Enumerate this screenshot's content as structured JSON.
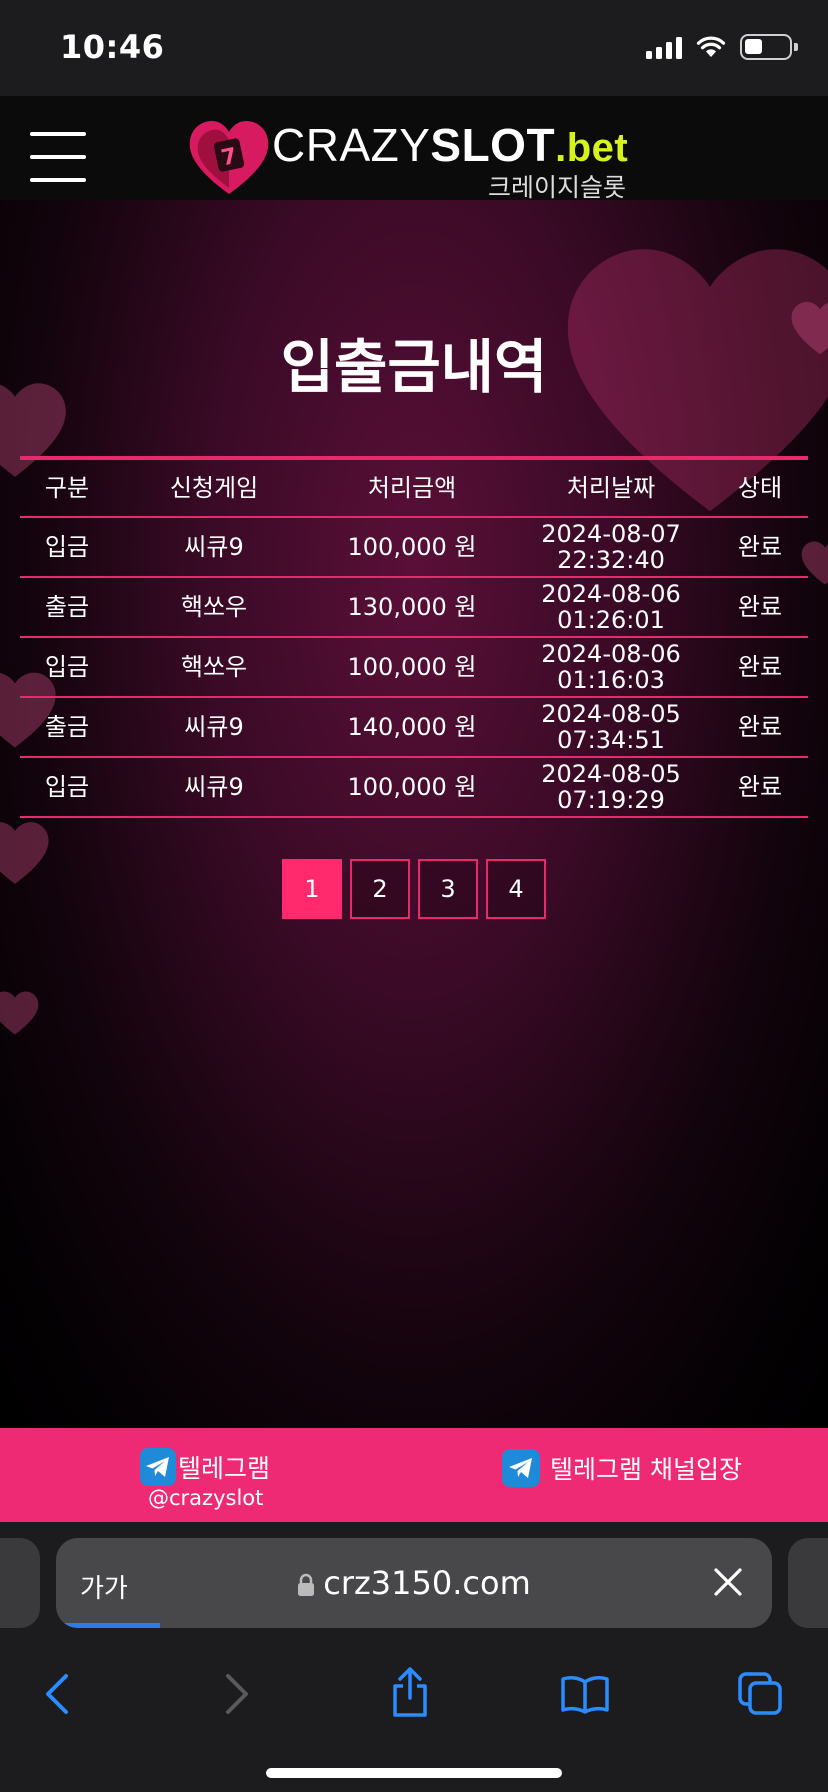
{
  "status_bar": {
    "time": "10:46"
  },
  "header": {
    "logo_crazy": "CRAZY",
    "logo_slot": "SLOT",
    "logo_bet": ".bet",
    "logo_korean": "크레이지슬롯"
  },
  "page": {
    "title": "입출금내역"
  },
  "table": {
    "headers": [
      "구분",
      "신청게임",
      "처리금액",
      "처리날짜",
      "상태"
    ],
    "rows": [
      {
        "type": "입금",
        "game": "씨큐9",
        "amount": "100,000 원",
        "date": "2024-08-07",
        "time": "22:32:40",
        "status": "완료"
      },
      {
        "type": "출금",
        "game": "핵쏘우",
        "amount": "130,000 원",
        "date": "2024-08-06",
        "time": "01:26:01",
        "status": "완료"
      },
      {
        "type": "입금",
        "game": "핵쏘우",
        "amount": "100,000 원",
        "date": "2024-08-06",
        "time": "01:16:03",
        "status": "완료"
      },
      {
        "type": "출금",
        "game": "씨큐9",
        "amount": "140,000 원",
        "date": "2024-08-05",
        "time": "07:34:51",
        "status": "완료"
      },
      {
        "type": "입금",
        "game": "씨큐9",
        "amount": "100,000 원",
        "date": "2024-08-05",
        "time": "07:19:29",
        "status": "완료"
      }
    ]
  },
  "pagination": {
    "pages": [
      "1",
      "2",
      "3",
      "4"
    ],
    "active": "1"
  },
  "telegram": {
    "left_label": "텔레그램",
    "left_handle": "@crazyslot",
    "right_label": "텔레그램 채널입장"
  },
  "browser": {
    "text_size_label": "가가",
    "url": "crz3150.com"
  },
  "colors": {
    "accent": "#ee2a74",
    "active_page": "#ff2a6d",
    "table_line": "#e8296b",
    "logo_bet": "#d6f21c"
  }
}
